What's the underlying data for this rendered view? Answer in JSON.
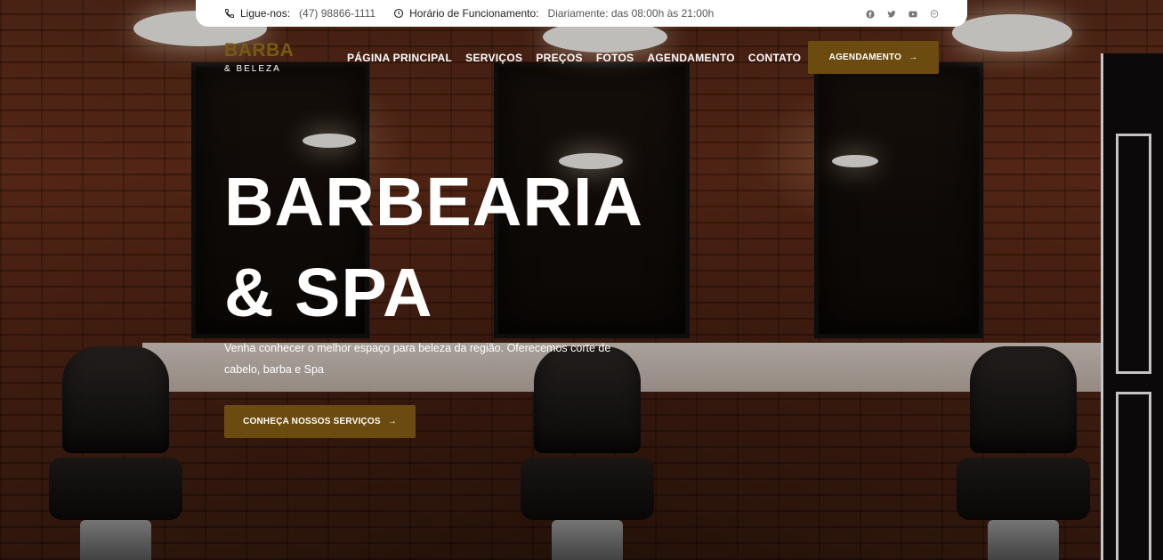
{
  "topbar": {
    "phone_label": "Ligue-nos:",
    "phone_value": "(47) 98866-1111",
    "hours_label": "Horário de Funcionamento:",
    "hours_value": "Diariamente: das 08:00h às 21:00h",
    "icons": [
      "phone-icon",
      "clock-icon",
      "facebook-icon",
      "twitter-icon",
      "youtube-icon",
      "chat-icon"
    ]
  },
  "logo": {
    "line1": "BARBA",
    "line2": "& BELEZA"
  },
  "nav": {
    "items": [
      "PÁGINA PRINCIPAL",
      "SERVIÇOS",
      "PREÇOS",
      "FOTOS",
      "AGENDAMENTO",
      "CONTATO"
    ]
  },
  "header_button": {
    "label": "AGENDAMENTO",
    "arrow": "→"
  },
  "hero": {
    "title_line1": "BARBEARIA",
    "title_line2": "& SPA",
    "subtitle": "Venha conhecer o melhor espaço para beleza da região. Oferecemos corte de cabelo, barba e Spa",
    "button_label": "CONHEÇA NOSSOS SERVIÇOS",
    "button_arrow": "→"
  },
  "colors": {
    "accent": "#6b4b0f",
    "logo": "#7a5a12",
    "topbar_bg": "#ffffff"
  }
}
